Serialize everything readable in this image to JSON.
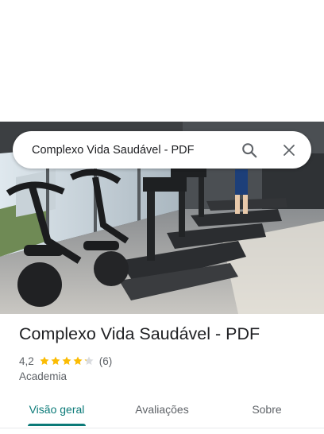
{
  "search": {
    "query": "Complexo Vida Saudável - PDF",
    "search_icon": "search-icon",
    "close_icon": "close-icon"
  },
  "hero_photo": {
    "description_icon": "gym-photo"
  },
  "place": {
    "title": "Complexo Vida Saudável - PDF",
    "rating": "4,2",
    "rating_fraction": 0.84,
    "review_count": "(6)",
    "category": "Academia"
  },
  "colors": {
    "star": "#fbbc04",
    "star_empty": "#dadce0",
    "accent": "#0b7a78"
  },
  "tabs": [
    {
      "label": "Visão geral",
      "active": true
    },
    {
      "label": "Avaliações",
      "active": false
    },
    {
      "label": "Sobre",
      "active": false
    }
  ]
}
